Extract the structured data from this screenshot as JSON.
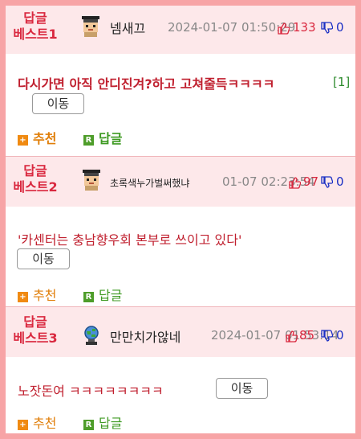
{
  "replies": [
    {
      "badge_line1": "답글",
      "badge_line2": "베스트1",
      "nickname": "넴새끄",
      "datetime": "2024-01-07 01:50:29",
      "upvotes": "133",
      "downvotes": "0",
      "content": "다시가면 아직 안디진겨?하고 고쳐줄득ㅋㅋㅋㅋ",
      "reply_count": "[1]",
      "move_label": "이동",
      "recommend_label": "추천",
      "reply_label": "답글",
      "avatar_icon": "pixel-man-avatar"
    },
    {
      "badge_line1": "답글",
      "badge_line2": "베스트2",
      "nickname": "초록색누가벌써했냐",
      "datetime": "01-07 02:23:54",
      "upvotes": "97",
      "downvotes": "0",
      "content": "'카센터는 충남향우회 본부로 쓰이고 있다'",
      "move_label": "이동",
      "recommend_label": "추천",
      "reply_label": "답글",
      "avatar_icon": "pixel-man-avatar"
    },
    {
      "badge_line1": "답글",
      "badge_line2": "베스트3",
      "nickname": "만만치가않네",
      "datetime": "2024-01-07 01:53:14",
      "upvotes": "85",
      "downvotes": "0",
      "content": "노잣돈여 ㅋㅋㅋㅋㅋㅋㅋㅋ",
      "move_label": "이동",
      "recommend_label": "추천",
      "reply_label": "답글",
      "avatar_icon": "blue-globe-avatar"
    }
  ],
  "colors": {
    "frame": "#f7a4a6",
    "header_bg": "#fde8ea",
    "accent_red": "#d9283f",
    "down_blue": "#1a2fc4",
    "recommend_orange": "#f08a12",
    "reply_green": "#4e9d2a"
  }
}
